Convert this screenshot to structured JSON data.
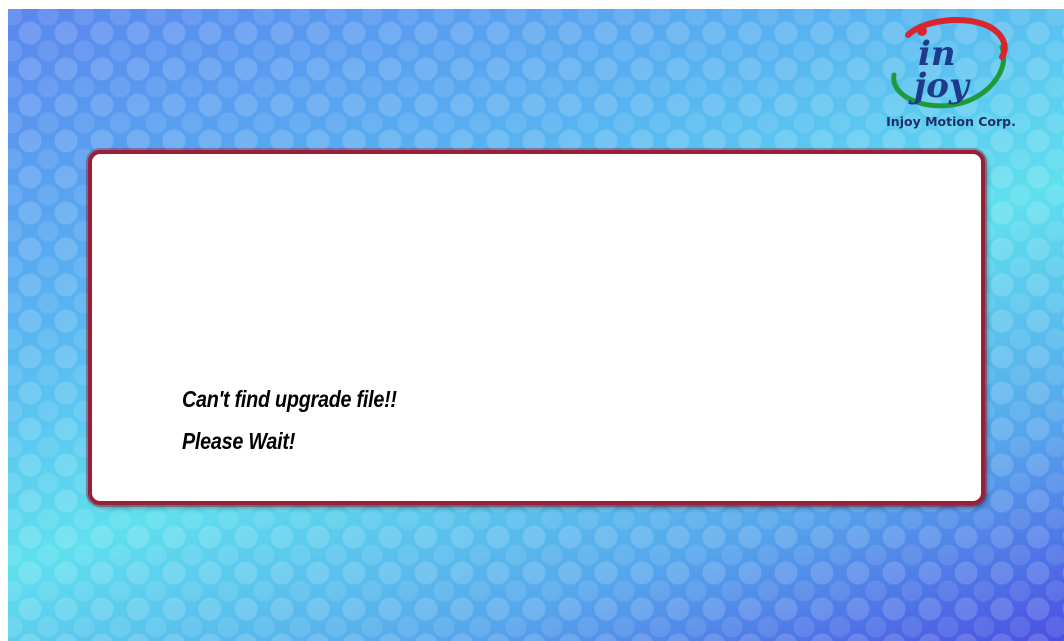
{
  "logo": {
    "mark_line1": "in",
    "mark_line2": "joy",
    "company_name": "Injoy Motion Corp."
  },
  "dialog": {
    "messages": [
      "Can't find upgrade file!!",
      "Please Wait!"
    ]
  },
  "colors": {
    "dialog_border": "#9c1f3a",
    "logo_text": "#1f2f66",
    "logo_ring_red": "#d9252e",
    "logo_ring_green": "#1f9a3a"
  }
}
